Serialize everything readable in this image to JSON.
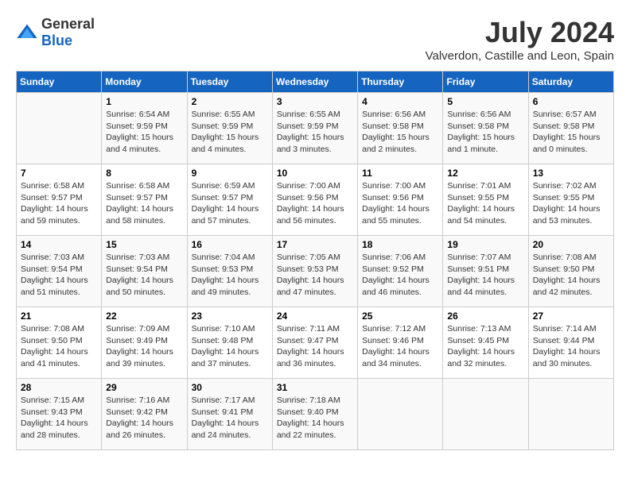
{
  "header": {
    "logo_general": "General",
    "logo_blue": "Blue",
    "title": "July 2024",
    "subtitle": "Valverdon, Castille and Leon, Spain"
  },
  "calendar": {
    "headers": [
      "Sunday",
      "Monday",
      "Tuesday",
      "Wednesday",
      "Thursday",
      "Friday",
      "Saturday"
    ],
    "weeks": [
      [
        {
          "day": "",
          "info": ""
        },
        {
          "day": "1",
          "info": "Sunrise: 6:54 AM\nSunset: 9:59 PM\nDaylight: 15 hours\nand 4 minutes."
        },
        {
          "day": "2",
          "info": "Sunrise: 6:55 AM\nSunset: 9:59 PM\nDaylight: 15 hours\nand 4 minutes."
        },
        {
          "day": "3",
          "info": "Sunrise: 6:55 AM\nSunset: 9:59 PM\nDaylight: 15 hours\nand 3 minutes."
        },
        {
          "day": "4",
          "info": "Sunrise: 6:56 AM\nSunset: 9:58 PM\nDaylight: 15 hours\nand 2 minutes."
        },
        {
          "day": "5",
          "info": "Sunrise: 6:56 AM\nSunset: 9:58 PM\nDaylight: 15 hours\nand 1 minute."
        },
        {
          "day": "6",
          "info": "Sunrise: 6:57 AM\nSunset: 9:58 PM\nDaylight: 15 hours\nand 0 minutes."
        }
      ],
      [
        {
          "day": "7",
          "info": "Sunrise: 6:58 AM\nSunset: 9:57 PM\nDaylight: 14 hours\nand 59 minutes."
        },
        {
          "day": "8",
          "info": "Sunrise: 6:58 AM\nSunset: 9:57 PM\nDaylight: 14 hours\nand 58 minutes."
        },
        {
          "day": "9",
          "info": "Sunrise: 6:59 AM\nSunset: 9:57 PM\nDaylight: 14 hours\nand 57 minutes."
        },
        {
          "day": "10",
          "info": "Sunrise: 7:00 AM\nSunset: 9:56 PM\nDaylight: 14 hours\nand 56 minutes."
        },
        {
          "day": "11",
          "info": "Sunrise: 7:00 AM\nSunset: 9:56 PM\nDaylight: 14 hours\nand 55 minutes."
        },
        {
          "day": "12",
          "info": "Sunrise: 7:01 AM\nSunset: 9:55 PM\nDaylight: 14 hours\nand 54 minutes."
        },
        {
          "day": "13",
          "info": "Sunrise: 7:02 AM\nSunset: 9:55 PM\nDaylight: 14 hours\nand 53 minutes."
        }
      ],
      [
        {
          "day": "14",
          "info": "Sunrise: 7:03 AM\nSunset: 9:54 PM\nDaylight: 14 hours\nand 51 minutes."
        },
        {
          "day": "15",
          "info": "Sunrise: 7:03 AM\nSunset: 9:54 PM\nDaylight: 14 hours\nand 50 minutes."
        },
        {
          "day": "16",
          "info": "Sunrise: 7:04 AM\nSunset: 9:53 PM\nDaylight: 14 hours\nand 49 minutes."
        },
        {
          "day": "17",
          "info": "Sunrise: 7:05 AM\nSunset: 9:53 PM\nDaylight: 14 hours\nand 47 minutes."
        },
        {
          "day": "18",
          "info": "Sunrise: 7:06 AM\nSunset: 9:52 PM\nDaylight: 14 hours\nand 46 minutes."
        },
        {
          "day": "19",
          "info": "Sunrise: 7:07 AM\nSunset: 9:51 PM\nDaylight: 14 hours\nand 44 minutes."
        },
        {
          "day": "20",
          "info": "Sunrise: 7:08 AM\nSunset: 9:50 PM\nDaylight: 14 hours\nand 42 minutes."
        }
      ],
      [
        {
          "day": "21",
          "info": "Sunrise: 7:08 AM\nSunset: 9:50 PM\nDaylight: 14 hours\nand 41 minutes."
        },
        {
          "day": "22",
          "info": "Sunrise: 7:09 AM\nSunset: 9:49 PM\nDaylight: 14 hours\nand 39 minutes."
        },
        {
          "day": "23",
          "info": "Sunrise: 7:10 AM\nSunset: 9:48 PM\nDaylight: 14 hours\nand 37 minutes."
        },
        {
          "day": "24",
          "info": "Sunrise: 7:11 AM\nSunset: 9:47 PM\nDaylight: 14 hours\nand 36 minutes."
        },
        {
          "day": "25",
          "info": "Sunrise: 7:12 AM\nSunset: 9:46 PM\nDaylight: 14 hours\nand 34 minutes."
        },
        {
          "day": "26",
          "info": "Sunrise: 7:13 AM\nSunset: 9:45 PM\nDaylight: 14 hours\nand 32 minutes."
        },
        {
          "day": "27",
          "info": "Sunrise: 7:14 AM\nSunset: 9:44 PM\nDaylight: 14 hours\nand 30 minutes."
        }
      ],
      [
        {
          "day": "28",
          "info": "Sunrise: 7:15 AM\nSunset: 9:43 PM\nDaylight: 14 hours\nand 28 minutes."
        },
        {
          "day": "29",
          "info": "Sunrise: 7:16 AM\nSunset: 9:42 PM\nDaylight: 14 hours\nand 26 minutes."
        },
        {
          "day": "30",
          "info": "Sunrise: 7:17 AM\nSunset: 9:41 PM\nDaylight: 14 hours\nand 24 minutes."
        },
        {
          "day": "31",
          "info": "Sunrise: 7:18 AM\nSunset: 9:40 PM\nDaylight: 14 hours\nand 22 minutes."
        },
        {
          "day": "",
          "info": ""
        },
        {
          "day": "",
          "info": ""
        },
        {
          "day": "",
          "info": ""
        }
      ]
    ]
  }
}
